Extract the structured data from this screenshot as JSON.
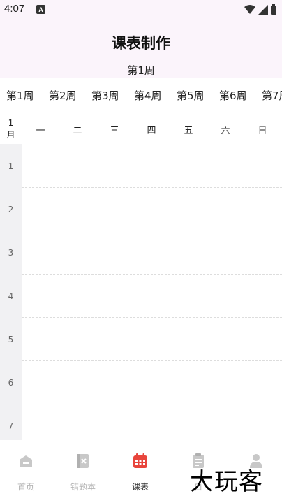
{
  "status_bar": {
    "time": "4:07",
    "notif_letter": "A"
  },
  "header": {
    "title": "课表制作",
    "current_week": "第1周"
  },
  "week_tabs": [
    "第1周",
    "第2周",
    "第3周",
    "第4周",
    "第5周",
    "第6周",
    "第7周"
  ],
  "day_header": {
    "month_number": "1",
    "month_unit": "月",
    "days": [
      "一",
      "二",
      "三",
      "四",
      "五",
      "六",
      "日"
    ]
  },
  "periods": [
    "1",
    "2",
    "3",
    "4",
    "5",
    "6",
    "7"
  ],
  "nav": {
    "items": [
      {
        "label": "首页",
        "icon": "home-icon",
        "active": false
      },
      {
        "label": "错题本",
        "icon": "error-book-icon",
        "active": false
      },
      {
        "label": "课表",
        "icon": "calendar-icon",
        "active": true
      },
      {
        "label": "自",
        "icon": "clipboard-icon",
        "active": false
      },
      {
        "label": "",
        "icon": "profile-icon",
        "active": false
      }
    ]
  },
  "watermark": "大玩客",
  "colors": {
    "accent": "#e8453c",
    "header_bg": "#fbf4fb",
    "period_bg": "#f1f1f3"
  }
}
